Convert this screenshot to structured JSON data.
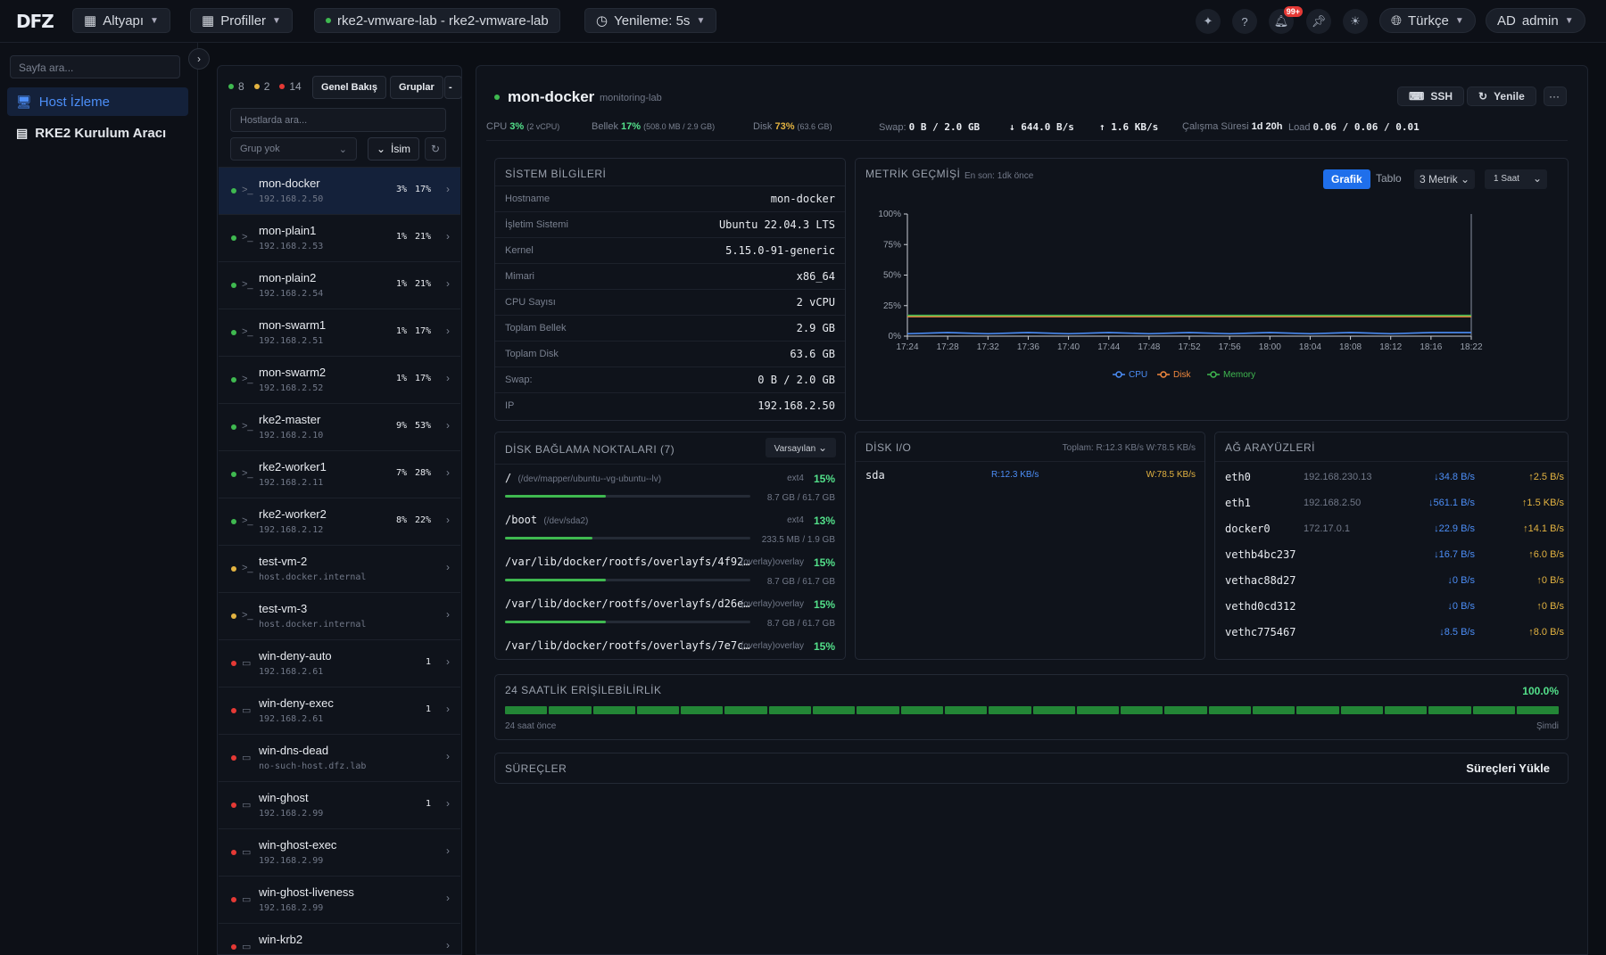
{
  "app": {
    "logo": "DFZ"
  },
  "topbar": {
    "altyapi": "Altyapı",
    "profiller": "Profiller",
    "cluster": "rke2-vmware-lab - rke2-vmware-lab",
    "refresh": "Yenileme: 5s",
    "notif_badge": "99+",
    "language": "Türkçe",
    "user_initials": "AD",
    "user": "admin"
  },
  "sidebar": {
    "search_placeholder": "Sayfa ara...",
    "items": [
      {
        "label": "Host İzleme",
        "icon": "monitor-icon"
      },
      {
        "label": "RKE2 Kurulum Aracı",
        "icon": "server-icon"
      }
    ]
  },
  "hostpanel": {
    "count_green": "8",
    "count_yellow": "2",
    "count_red": "14",
    "tab_overview": "Genel Bakış",
    "tab_groups": "Gruplar",
    "search_placeholder": "Hostlarda ara...",
    "group_placeholder": "Grup yok",
    "sort_label": "İsim",
    "hosts": [
      {
        "name": "mon-docker",
        "ip": "192.168.2.50",
        "cpu": "3%",
        "mem": "17%",
        "status": "green",
        "icon": "terminal-icon",
        "count": ""
      },
      {
        "name": "mon-plain1",
        "ip": "192.168.2.53",
        "cpu": "1%",
        "mem": "21%",
        "status": "green",
        "icon": "terminal-icon",
        "count": ""
      },
      {
        "name": "mon-plain2",
        "ip": "192.168.2.54",
        "cpu": "1%",
        "mem": "21%",
        "status": "green",
        "icon": "terminal-icon",
        "count": ""
      },
      {
        "name": "mon-swarm1",
        "ip": "192.168.2.51",
        "cpu": "1%",
        "mem": "17%",
        "status": "green",
        "icon": "terminal-icon",
        "count": ""
      },
      {
        "name": "mon-swarm2",
        "ip": "192.168.2.52",
        "cpu": "1%",
        "mem": "17%",
        "status": "green",
        "icon": "terminal-icon",
        "count": ""
      },
      {
        "name": "rke2-master",
        "ip": "192.168.2.10",
        "cpu": "9%",
        "mem": "53%",
        "status": "green",
        "icon": "terminal-icon",
        "count": ""
      },
      {
        "name": "rke2-worker1",
        "ip": "192.168.2.11",
        "cpu": "7%",
        "mem": "28%",
        "status": "green",
        "icon": "terminal-icon",
        "count": ""
      },
      {
        "name": "rke2-worker2",
        "ip": "192.168.2.12",
        "cpu": "8%",
        "mem": "22%",
        "status": "green",
        "icon": "terminal-icon",
        "count": ""
      },
      {
        "name": "test-vm-2",
        "ip": "host.docker.internal",
        "cpu": "",
        "mem": "",
        "status": "yellow",
        "icon": "terminal-icon",
        "count": ""
      },
      {
        "name": "test-vm-3",
        "ip": "host.docker.internal",
        "cpu": "",
        "mem": "",
        "status": "yellow",
        "icon": "terminal-icon",
        "count": ""
      },
      {
        "name": "win-deny-auto",
        "ip": "192.168.2.61",
        "cpu": "",
        "mem": "",
        "status": "red",
        "icon": "window-icon",
        "count": "1"
      },
      {
        "name": "win-deny-exec",
        "ip": "192.168.2.61",
        "cpu": "",
        "mem": "",
        "status": "red",
        "icon": "window-icon",
        "count": "1"
      },
      {
        "name": "win-dns-dead",
        "ip": "no-such-host.dfz.lab",
        "cpu": "",
        "mem": "",
        "status": "red",
        "icon": "window-icon",
        "count": ""
      },
      {
        "name": "win-ghost",
        "ip": "192.168.2.99",
        "cpu": "",
        "mem": "",
        "status": "red",
        "icon": "window-icon",
        "count": "1"
      },
      {
        "name": "win-ghost-exec",
        "ip": "192.168.2.99",
        "cpu": "",
        "mem": "",
        "status": "red",
        "icon": "window-icon",
        "count": ""
      },
      {
        "name": "win-ghost-liveness",
        "ip": "192.168.2.99",
        "cpu": "",
        "mem": "",
        "status": "red",
        "icon": "window-icon",
        "count": ""
      },
      {
        "name": "win-krb2",
        "ip": "",
        "cpu": "",
        "mem": "",
        "status": "red",
        "icon": "window-icon",
        "count": ""
      }
    ]
  },
  "detail": {
    "name": "mon-docker",
    "group": "monitoring-lab",
    "ssh": "SSH",
    "refresh": "Yenile",
    "more": "···",
    "stats": {
      "cpu_label": "CPU",
      "cpu": "3%",
      "cpu_sub": "(2 vCPU)",
      "mem_label": "Bellek",
      "mem": "17%",
      "mem_sub": "(508.0 MB / 2.9 GB)",
      "disk_label": "Disk",
      "disk": "73%",
      "disk_sub": "(63.6 GB)",
      "swap_label": "Swap:",
      "swap": "0 B / 2.0 GB",
      "net_down": "↓ 644.0 B/s",
      "net_up": "↑ 1.6 KB/s",
      "uptime_label": "Çalışma Süresi",
      "uptime": "1d 20h",
      "load_label": "Load",
      "load": "0.06 / 0.06 / 0.01"
    },
    "sysinfo": {
      "title": "SİSTEM BİLGİLERİ",
      "rows": [
        {
          "k": "Hostname",
          "v": "mon-docker"
        },
        {
          "k": "İşletim Sistemi",
          "v": "Ubuntu 22.04.3 LTS"
        },
        {
          "k": "Kernel",
          "v": "5.15.0-91-generic"
        },
        {
          "k": "Mimari",
          "v": "x86_64"
        },
        {
          "k": "CPU Sayısı",
          "v": "2 vCPU"
        },
        {
          "k": "Toplam Bellek",
          "v": "2.9 GB"
        },
        {
          "k": "Toplam Disk",
          "v": "63.6 GB"
        },
        {
          "k": "Swap:",
          "v": "0 B / 2.0 GB"
        },
        {
          "k": "IP",
          "v": "192.168.2.50"
        }
      ]
    },
    "metrics": {
      "title": "METRİK GEÇMİŞİ",
      "last": "En son: 1dk önce",
      "tab_chart": "Grafik",
      "tab_table": "Tablo",
      "metric_count": "3 Metrik",
      "range": "1 Saat"
    },
    "mounts": {
      "title": "DİSK BAĞLAMA NOKTALARI (7)",
      "sort": "Varsayılan",
      "items": [
        {
          "path": "/",
          "dev": "(/dev/mapper/ubuntu--vg-ubuntu--lv)",
          "fs": "ext4",
          "pct": "15%",
          "fill": 0.15,
          "size": "8.7 GB / 61.7 GB"
        },
        {
          "path": "/boot",
          "dev": "(/dev/sda2)",
          "fs": "ext4",
          "pct": "13%",
          "fill": 0.13,
          "size": "233.5 MB / 1.9 GB"
        },
        {
          "path": "/var/lib/docker/rootfs/overlayfs/4f92…",
          "dev": "",
          "fs": "(overlay)overlay",
          "pct": "15%",
          "fill": 0.15,
          "size": "8.7 GB / 61.7 GB"
        },
        {
          "path": "/var/lib/docker/rootfs/overlayfs/d26e…",
          "dev": "",
          "fs": "(overlay)overlay",
          "pct": "15%",
          "fill": 0.15,
          "size": "8.7 GB / 61.7 GB"
        },
        {
          "path": "/var/lib/docker/rootfs/overlayfs/7e7c…",
          "dev": "",
          "fs": "(overlay)overlay",
          "pct": "15%",
          "fill": 0.15,
          "size": "8.7 GB / 61.7 GB"
        }
      ]
    },
    "diskio": {
      "title": "DİSK I/O",
      "total": "Toplam: R:12.3 KB/s W:78.5 KB/s",
      "dev": "sda",
      "r": "R:12.3 KB/s",
      "w": "W:78.5 KB/s"
    },
    "net": {
      "title": "AĞ ARAYÜZLERİ",
      "rows": [
        {
          "n": "eth0",
          "ip": "192.168.230.13",
          "rx": "↓34.8 B/s",
          "tx": "↑2.5 B/s"
        },
        {
          "n": "eth1",
          "ip": "192.168.2.50",
          "rx": "↓561.1 B/s",
          "tx": "↑1.5 KB/s"
        },
        {
          "n": "docker0",
          "ip": "172.17.0.1",
          "rx": "↓22.9 B/s",
          "tx": "↑14.1 B/s"
        },
        {
          "n": "vethb4bc237",
          "ip": "",
          "rx": "↓16.7 B/s",
          "tx": "↑6.0 B/s"
        },
        {
          "n": "vethac88d27",
          "ip": "",
          "rx": "↓0 B/s",
          "tx": "↑0 B/s"
        },
        {
          "n": "vethd0cd312",
          "ip": "",
          "rx": "↓0 B/s",
          "tx": "↑0 B/s"
        },
        {
          "n": "vethc775467",
          "ip": "",
          "rx": "↓8.5 B/s",
          "tx": "↑8.0 B/s"
        }
      ]
    },
    "availability": {
      "title": "24 SAATLİK ERİŞİLEBİLİRLİK",
      "pct": "100.0%",
      "start": "24 saat önce",
      "end": "Şimdi",
      "segments": 24
    },
    "processes": {
      "title": "SÜREÇLER",
      "load": "Süreçleri Yükle"
    }
  },
  "chart_data": {
    "type": "line",
    "title": "",
    "x": [
      "17:24",
      "17:28",
      "17:32",
      "17:36",
      "17:40",
      "17:44",
      "17:48",
      "17:52",
      "17:56",
      "18:00",
      "18:04",
      "18:08",
      "18:12",
      "18:16",
      "18:22"
    ],
    "yticks": [
      "0%",
      "25%",
      "50%",
      "75%",
      "100%"
    ],
    "ylim": [
      0,
      100
    ],
    "series": [
      {
        "name": "CPU",
        "color": "#4c8ef7",
        "values": [
          2,
          3,
          2,
          3,
          2,
          3,
          2,
          3,
          2,
          3,
          2,
          3,
          2,
          3,
          3
        ]
      },
      {
        "name": "Disk",
        "color": "#f0883e",
        "values": [
          16,
          16,
          16,
          16,
          16,
          16,
          16,
          16,
          16,
          16,
          16,
          16,
          16,
          16,
          16
        ]
      },
      {
        "name": "Memory",
        "color": "#3fb950",
        "values": [
          17,
          17,
          17,
          17,
          17,
          17,
          17,
          17,
          17,
          17,
          17,
          17,
          17,
          17,
          17
        ]
      }
    ],
    "legend": "bottom"
  }
}
